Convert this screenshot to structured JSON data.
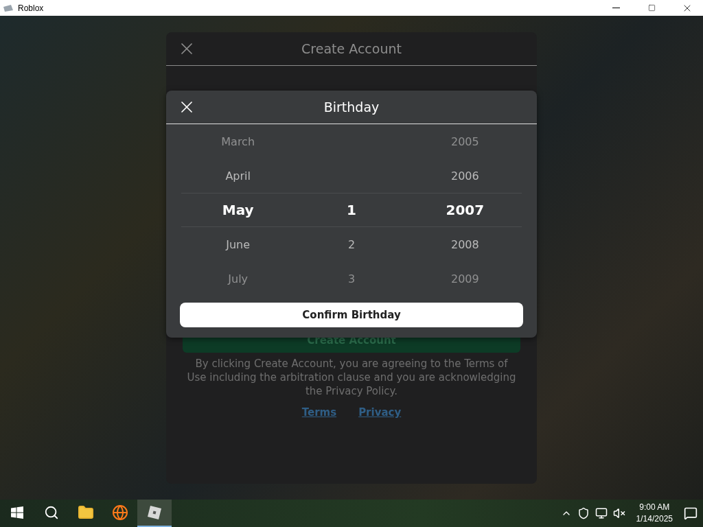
{
  "window": {
    "title": "Roblox"
  },
  "create_account": {
    "title": "Create Account",
    "create_button": "Create Account",
    "agreement": "By clicking Create Account, you are agreeing to the Terms of Use including the arbitration clause and you are acknowledging the Privacy Policy.",
    "links": [
      "Terms",
      "Privacy"
    ]
  },
  "birthday_picker": {
    "title": "Birthday",
    "rows": [
      {
        "month": "March",
        "year": "2005",
        "selected": false
      },
      {
        "month": "April",
        "year": "2006",
        "selected": false
      },
      {
        "month": "May",
        "day": "1",
        "year": "2007",
        "selected": true
      },
      {
        "month": "June",
        "day": "2",
        "year": "2008",
        "selected": false
      },
      {
        "month": "July",
        "day": "3",
        "year": "2009",
        "selected": false
      }
    ],
    "confirm_button": "Confirm Birthday"
  },
  "taskbar": {
    "apps": [
      {
        "kind": "start",
        "selected": false
      },
      {
        "kind": "search",
        "selected": false
      },
      {
        "kind": "folder",
        "selected": false
      },
      {
        "kind": "browser",
        "selected": false
      },
      {
        "kind": "roblox",
        "selected": true
      }
    ],
    "time": "9:00 AM",
    "date": "1/14/2025"
  }
}
